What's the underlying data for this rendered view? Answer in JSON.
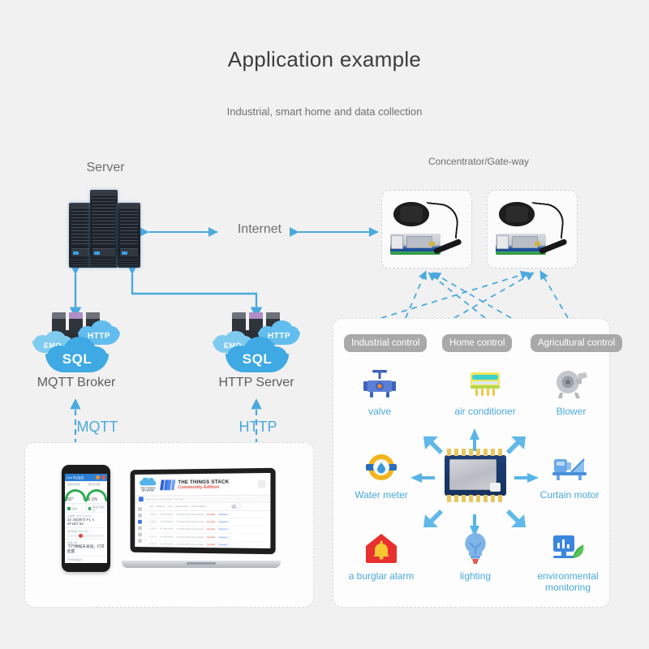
{
  "page": {
    "title": "Application example",
    "subtitle": "Industrial, smart home and data collection",
    "background_color": "#f1f1f1",
    "accent_color": "#4aa9dd"
  },
  "nodes": {
    "server": {
      "label": "Server",
      "icon": "server-rack-icon"
    },
    "internet": {
      "label": "Internet"
    },
    "gateway": {
      "label": "Concentrator/Gate-way",
      "count": 2,
      "icon": "lorawan-gateway-icon"
    },
    "mqtt_broker": {
      "label": "MQTT Broker",
      "cloud_tags": [
        "EMQ",
        "HTTP",
        "SQL"
      ]
    },
    "http_server": {
      "label": "HTTP Server",
      "cloud_tags": [
        "EMQ",
        "HTTP",
        "SQL"
      ]
    }
  },
  "links": {
    "mqtt": "MQTT",
    "http": "HTTP"
  },
  "clients": {
    "phone": {
      "app_title": "Lora 节点监控",
      "gauges": [
        {
          "caption": "温度传感器",
          "value": "32°"
        },
        {
          "caption": "湿度传感器",
          "value": "6.1%"
        }
      ],
      "chips": [
        {
          "label": "在线"
        },
        {
          "label": "网关正常运行"
        }
      ],
      "rows": [
        {
          "key": "设备唯一标识 DevEUI",
          "value": "22 34D873 F1 4 2F1B7 52"
        },
        {
          "key": "信号强度 RSSI dBm",
          "value": ""
        },
        {
          "key": "数据上报",
          "value": "下行数据未发送，打开配置"
        },
        {
          "key": "历史数据曲线",
          "value": ""
        }
      ]
    },
    "laptop": {
      "brand_cloud": "THE THINGS NETWORK",
      "title_line1": "THE THINGS STACK",
      "title_line2": "Community Edition",
      "breadcrumb": "Applications > my-lora-app > Live data",
      "table_headers": [
        "Time",
        "Entity ID",
        "Type",
        "Data preview",
        "Verbose stream"
      ],
      "rows": [
        {
          "time": "11:24:31",
          "entity": "eui-70b3d57ba",
          "type": "Forward uplink data message",
          "tag": "DevAddr",
          "blue": "Payload: 2"
        },
        {
          "time": "11:24:29",
          "entity": "eui-70b3d57ba",
          "type": "Forward uplink data message",
          "tag": "DevAddr",
          "blue": "Payload: 2"
        },
        {
          "time": "11:24:27",
          "entity": "eui-70b3d57ba",
          "type": "Forward uplink data message",
          "tag": "DevAddr",
          "blue": "Payload: 2"
        },
        {
          "time": "11:24:21",
          "entity": "eui-70b3d57ba",
          "type": "Forward uplink data message",
          "tag": "DevAddr",
          "blue": "Payload: 2"
        },
        {
          "time": "11:24:18",
          "entity": "eui-70b3d57ba",
          "type": "Forward uplink data message",
          "tag": "DevAddr",
          "blue": "Payload: 2"
        },
        {
          "time": "11:24:12",
          "entity": "eui-70b3d57ba",
          "type": "Forward uplink data message",
          "tag": "DevAddr",
          "blue": "Payload: 2"
        }
      ]
    }
  },
  "device_panel": {
    "categories": [
      {
        "id": "industrial",
        "label": "Industrial control"
      },
      {
        "id": "home",
        "label": "Home control"
      },
      {
        "id": "agricultural",
        "label": "Agricultural control"
      }
    ],
    "center_module": {
      "name": "lora-module-icon"
    },
    "devices": [
      {
        "id": "valve",
        "label": "valve",
        "icon": "valve-icon"
      },
      {
        "id": "air-conditioner",
        "label": "air conditioner",
        "icon": "air-conditioner-icon"
      },
      {
        "id": "blower",
        "label": "Blower",
        "icon": "blower-icon"
      },
      {
        "id": "water-meter",
        "label": "Water meter",
        "icon": "water-meter-icon"
      },
      {
        "id": "curtain-motor",
        "label": "Curtain motor",
        "icon": "curtain-motor-icon"
      },
      {
        "id": "burglar-alarm",
        "label": "a burglar alarm",
        "icon": "burglar-alarm-icon"
      },
      {
        "id": "lighting",
        "label": "lighting",
        "icon": "light-bulb-icon"
      },
      {
        "id": "environmental-monitoring",
        "label": "environmental monitoring",
        "icon": "environment-monitor-icon"
      }
    ]
  }
}
